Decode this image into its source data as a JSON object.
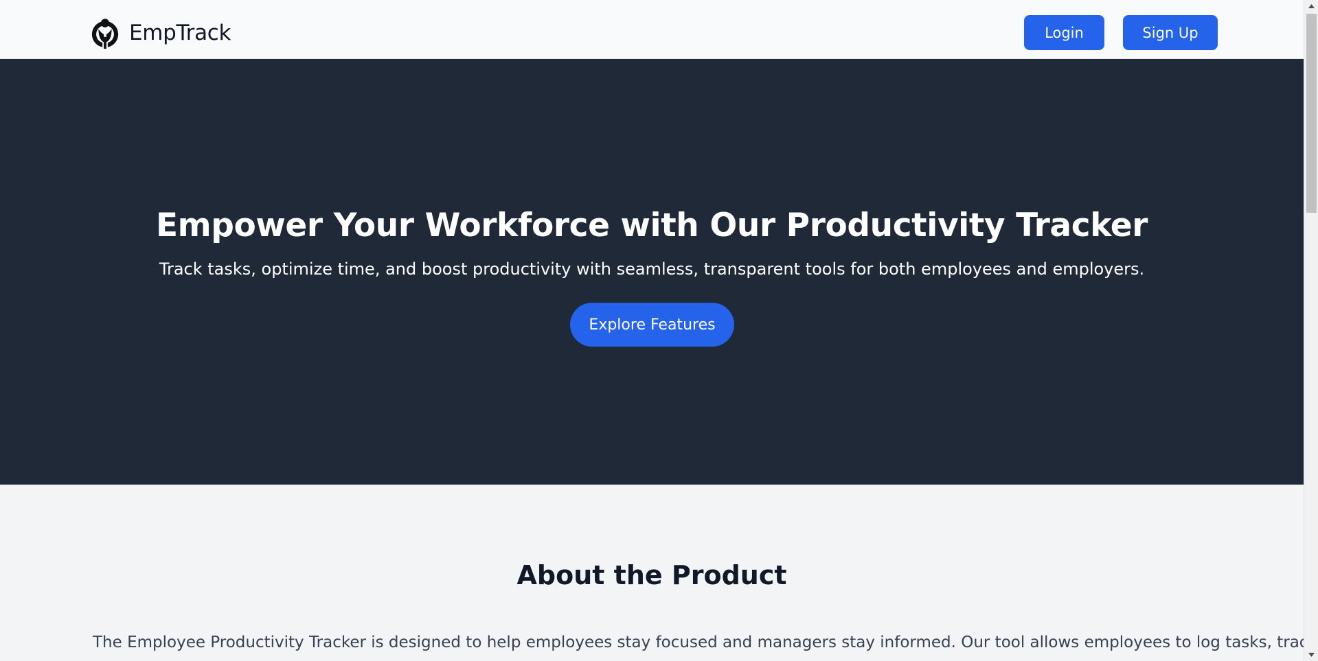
{
  "header": {
    "brand_name": "EmpTrack",
    "logo_icon": "wikimedia-style-logo-icon",
    "login_label": "Login",
    "signup_label": "Sign Up"
  },
  "hero": {
    "title": "Empower Your Workforce with Our Productivity Tracker",
    "subtitle": "Track tasks, optimize time, and boost productivity with seamless, transparent tools for both employees and employers.",
    "cta_label": "Explore Features"
  },
  "about": {
    "title": "About the Product",
    "text": "The Employee Productivity Tracker is designed to help employees stay focused and managers stay informed. Our tool allows employees to log tasks, track"
  },
  "colors": {
    "accent": "#2563eb",
    "hero_bg": "#1f2937",
    "page_bg": "#f3f4f6",
    "header_bg": "#f9fafb"
  }
}
